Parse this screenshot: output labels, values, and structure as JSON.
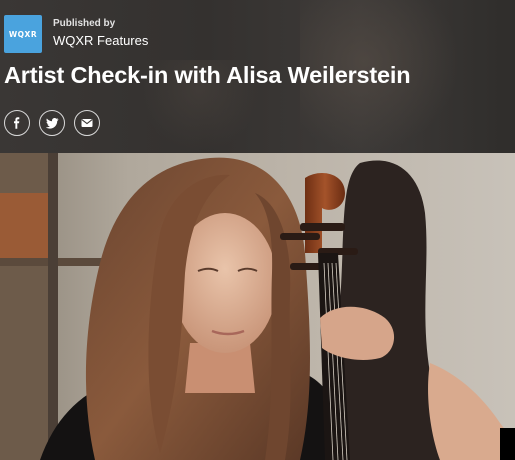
{
  "publisher": {
    "logo_text": "WQXR",
    "label": "Published by",
    "name": "WQXR Features"
  },
  "article": {
    "title": "Artist Check-in with Alisa Weilerstein"
  },
  "share_buttons": [
    {
      "icon": "facebook-icon"
    },
    {
      "icon": "twitter-icon"
    },
    {
      "icon": "email-icon"
    }
  ],
  "colors": {
    "logo_bg": "#4aa3de",
    "header_bg": "#363331",
    "text": "#ffffff"
  }
}
